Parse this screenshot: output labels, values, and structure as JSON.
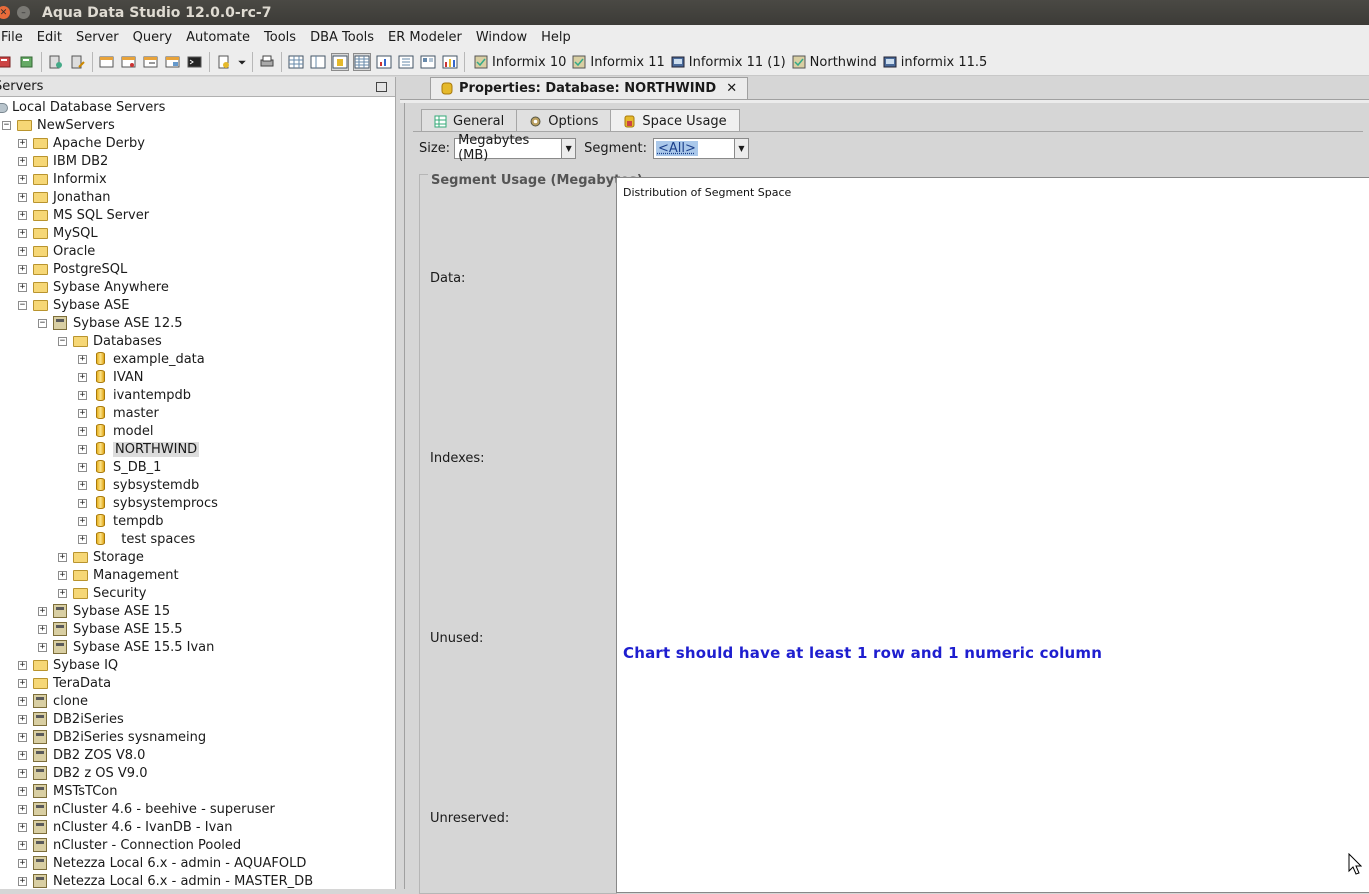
{
  "window": {
    "title": "Aqua Data Studio 12.0.0-rc-7"
  },
  "menu": [
    "File",
    "Edit",
    "Server",
    "Query",
    "Automate",
    "Tools",
    "DBA Tools",
    "ER Modeler",
    "Window",
    "Help"
  ],
  "server_tabs": [
    "Informix 10",
    "Informix 11",
    "Informix 11 (1)",
    "Northwind",
    "informix 11.5"
  ],
  "left_panel": {
    "title": "Servers",
    "tree": [
      {
        "label": "Local Database Servers",
        "level": 0,
        "icon": "cloud",
        "expander": "none"
      },
      {
        "label": "NewServers",
        "level": 1,
        "icon": "folder",
        "expander": "minus"
      },
      {
        "label": "Apache Derby",
        "level": 2,
        "icon": "folder",
        "expander": "plus"
      },
      {
        "label": "IBM DB2",
        "level": 2,
        "icon": "folder",
        "expander": "plus"
      },
      {
        "label": "Informix",
        "level": 2,
        "icon": "folder",
        "expander": "plus"
      },
      {
        "label": "Jonathan",
        "level": 2,
        "icon": "folder",
        "expander": "plus"
      },
      {
        "label": "MS SQL Server",
        "level": 2,
        "icon": "folder",
        "expander": "plus"
      },
      {
        "label": "MySQL",
        "level": 2,
        "icon": "folder",
        "expander": "plus"
      },
      {
        "label": "Oracle",
        "level": 2,
        "icon": "folder",
        "expander": "plus"
      },
      {
        "label": "PostgreSQL",
        "level": 2,
        "icon": "folder",
        "expander": "plus"
      },
      {
        "label": "Sybase Anywhere",
        "level": 2,
        "icon": "folder",
        "expander": "plus"
      },
      {
        "label": "Sybase ASE",
        "level": 2,
        "icon": "folder",
        "expander": "minus"
      },
      {
        "label": "Sybase ASE 12.5",
        "level": 3,
        "icon": "server",
        "expander": "minus"
      },
      {
        "label": "Databases",
        "level": 4,
        "icon": "folder",
        "expander": "minus"
      },
      {
        "label": "example_data",
        "level": 5,
        "icon": "db",
        "expander": "plus"
      },
      {
        "label": "IVAN",
        "level": 5,
        "icon": "db",
        "expander": "plus"
      },
      {
        "label": "ivantempdb",
        "level": 5,
        "icon": "db",
        "expander": "plus"
      },
      {
        "label": "master",
        "level": 5,
        "icon": "db",
        "expander": "plus"
      },
      {
        "label": "model",
        "level": 5,
        "icon": "db",
        "expander": "plus"
      },
      {
        "label": "NORTHWIND",
        "level": 5,
        "icon": "db",
        "expander": "plus",
        "selected": true
      },
      {
        "label": "S_DB_1",
        "level": 5,
        "icon": "db",
        "expander": "plus"
      },
      {
        "label": "sybsystemdb",
        "level": 5,
        "icon": "db",
        "expander": "plus"
      },
      {
        "label": "sybsystemprocs",
        "level": 5,
        "icon": "db",
        "expander": "plus"
      },
      {
        "label": "tempdb",
        "level": 5,
        "icon": "db",
        "expander": "plus"
      },
      {
        "label": "  test spaces",
        "level": 5,
        "icon": "db",
        "expander": "plus"
      },
      {
        "label": "Storage",
        "level": 4,
        "icon": "folder",
        "expander": "plus"
      },
      {
        "label": "Management",
        "level": 4,
        "icon": "folder",
        "expander": "plus"
      },
      {
        "label": "Security",
        "level": 4,
        "icon": "folder",
        "expander": "plus"
      },
      {
        "label": "Sybase ASE 15",
        "level": 3,
        "icon": "server",
        "expander": "plus"
      },
      {
        "label": "Sybase ASE 15.5",
        "level": 3,
        "icon": "server",
        "expander": "plus"
      },
      {
        "label": "Sybase ASE 15.5 Ivan",
        "level": 3,
        "icon": "server",
        "expander": "plus"
      },
      {
        "label": "Sybase IQ",
        "level": 2,
        "icon": "folder",
        "expander": "plus"
      },
      {
        "label": "TeraData",
        "level": 2,
        "icon": "folder",
        "expander": "plus"
      },
      {
        "label": "clone",
        "level": 2,
        "icon": "server",
        "expander": "plus"
      },
      {
        "label": "DB2iSeries",
        "level": 2,
        "icon": "server",
        "expander": "plus"
      },
      {
        "label": "DB2iSeries sysnameing",
        "level": 2,
        "icon": "server",
        "expander": "plus"
      },
      {
        "label": "DB2 ZOS V8.0",
        "level": 2,
        "icon": "server",
        "expander": "plus"
      },
      {
        "label": "DB2 z OS V9.0",
        "level": 2,
        "icon": "server",
        "expander": "plus"
      },
      {
        "label": "MSTsTCon",
        "level": 2,
        "icon": "server",
        "expander": "plus"
      },
      {
        "label": "nCluster 4.6 - beehive - superuser",
        "level": 2,
        "icon": "server",
        "expander": "plus"
      },
      {
        "label": "nCluster 4.6 - IvanDB - Ivan",
        "level": 2,
        "icon": "server",
        "expander": "plus"
      },
      {
        "label": "nCluster - Connection Pooled",
        "level": 2,
        "icon": "server",
        "expander": "plus"
      },
      {
        "label": "Netezza Local 6.x - admin - AQUAFOLD",
        "level": 2,
        "icon": "server",
        "expander": "plus"
      },
      {
        "label": "Netezza Local 6.x - admin - MASTER_DB",
        "level": 2,
        "icon": "server",
        "expander": "plus"
      }
    ]
  },
  "document": {
    "tab_title": "Properties: Database: NORTHWIND",
    "subtabs": [
      {
        "label": "General",
        "active": false
      },
      {
        "label": "Options",
        "active": false
      },
      {
        "label": "Space Usage",
        "active": true
      }
    ],
    "size_label": "Size:",
    "size_value": "Megabytes (MB)",
    "segment_label": "Segment:",
    "segment_value": "<All>",
    "segment_usage_title": "Segment Usage (Megabytes)",
    "usage_rows": [
      "Data:",
      "Indexes:",
      "Unused:",
      "Unreserved:"
    ],
    "chart_title": "Distribution of Segment Space",
    "chart_message": "Chart should have at least 1 row and 1 numeric column"
  },
  "colors": {
    "chart_message": "#1e1ecf",
    "titlebar": "#3c3b37",
    "selection": "#dcdcdc"
  }
}
